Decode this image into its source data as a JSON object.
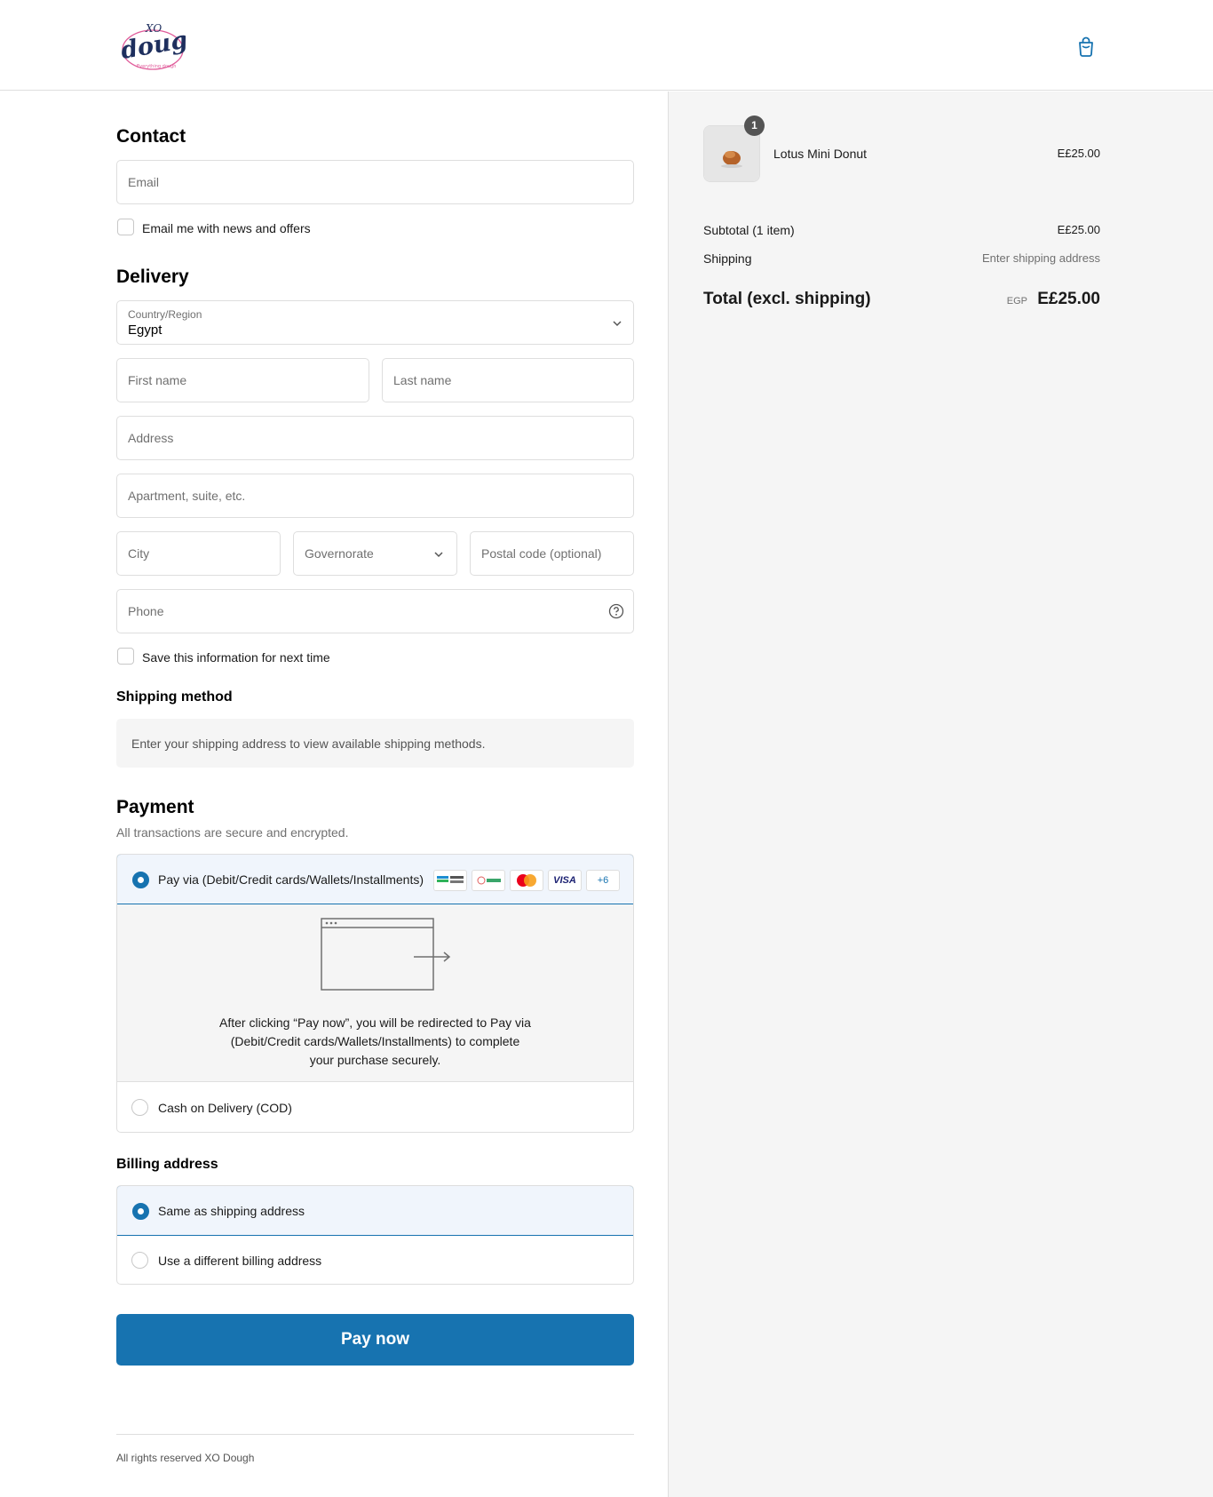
{
  "header": {
    "logo_alt_top": "XO",
    "logo_word": "dough",
    "logo_tag": "Everything dough"
  },
  "contact": {
    "title": "Contact",
    "email_placeholder": "Email",
    "newsletter_label": "Email me with news and offers"
  },
  "delivery": {
    "title": "Delivery",
    "country_label": "Country/Region",
    "country_value": "Egypt",
    "first_name": "First name",
    "last_name": "Last name",
    "address": "Address",
    "apartment": "Apartment, suite, etc.",
    "city": "City",
    "governorate": "Governorate",
    "postal": "Postal code (optional)",
    "phone": "Phone",
    "save_info_label": "Save this information for next time"
  },
  "shipping_method": {
    "title": "Shipping method",
    "info": "Enter your shipping address to view available shipping methods."
  },
  "payment": {
    "title": "Payment",
    "subtitle": "All transactions are secure and encrypted.",
    "option_gateway": "Pay via (Debit/Credit cards/Wallets/Installments)",
    "badge_more": "+6",
    "badge_visa": "VISA",
    "redirect_text_1": "After clicking “Pay now”, you will be redirected to Pay via",
    "redirect_text_2": "(Debit/Credit cards/Wallets/Installments) to complete",
    "redirect_text_3": "your purchase securely.",
    "option_cod": "Cash on Delivery (COD)"
  },
  "billing": {
    "title": "Billing address",
    "option_same": "Same as shipping address",
    "option_diff": "Use a different billing address"
  },
  "pay_button": "Pay now",
  "footer": "All rights reserved XO Dough",
  "summary": {
    "qty": "1",
    "product_name": "Lotus Mini Donut",
    "product_price": "E£25.00",
    "subtotal_label": "Subtotal (1 item)",
    "subtotal_value": "E£25.00",
    "shipping_label": "Shipping",
    "shipping_value": "Enter shipping address",
    "total_label": "Total (excl. shipping)",
    "total_currency": "EGP",
    "total_value": "E£25.00"
  },
  "colors": {
    "accent": "#1773b0",
    "panel_bg": "#f5f5f5",
    "border": "#dedede"
  }
}
